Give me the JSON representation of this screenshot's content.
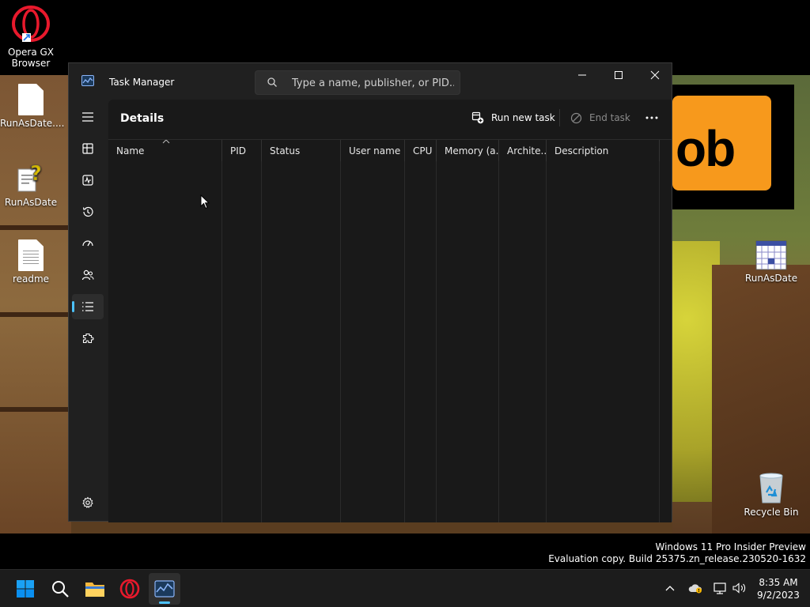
{
  "desktop": {
    "icons": [
      {
        "label": "Opera GX Browser",
        "icon": "opera-gx-icon"
      },
      {
        "label": "RunAsDate....",
        "icon": "document-icon"
      },
      {
        "label": "RunAsDate",
        "icon": "help-document-icon"
      },
      {
        "label": "readme",
        "icon": "text-document-icon"
      },
      {
        "label": "RunAsDate",
        "icon": "calendar-icon"
      },
      {
        "label": "Recycle Bin",
        "icon": "recycle-bin-icon"
      }
    ],
    "wallpaper_sign_text": "ob",
    "watermark": {
      "line1": "Windows 11 Pro Insider Preview",
      "line2": "Evaluation copy. Build 25375.zn_release.230520-1632"
    }
  },
  "window": {
    "title": "Task Manager",
    "search_placeholder": "Type a name, publisher, or PID...",
    "page_title": "Details",
    "toolbar": {
      "run_new_task": "Run new task",
      "end_task": "End task"
    },
    "nav": [
      {
        "name": "nav-hamburger",
        "icon": "menu-icon"
      },
      {
        "name": "nav-processes",
        "icon": "processes-icon"
      },
      {
        "name": "nav-performance",
        "icon": "performance-icon"
      },
      {
        "name": "nav-app-history",
        "icon": "history-icon"
      },
      {
        "name": "nav-startup-apps",
        "icon": "startup-icon"
      },
      {
        "name": "nav-users",
        "icon": "users-icon"
      },
      {
        "name": "nav-details",
        "icon": "details-list-icon",
        "active": true
      },
      {
        "name": "nav-services",
        "icon": "services-icon"
      },
      {
        "name": "nav-settings",
        "icon": "gear-icon"
      }
    ],
    "columns": [
      "Name",
      "PID",
      "Status",
      "User name",
      "CPU",
      "Memory (a...",
      "Archite...",
      "Description"
    ]
  },
  "taskbar": {
    "clock_time": "8:35 AM",
    "clock_date": "9/2/2023",
    "colors": {
      "accent": "#4cc2ff",
      "start_blue": "#0a8ff0"
    }
  }
}
